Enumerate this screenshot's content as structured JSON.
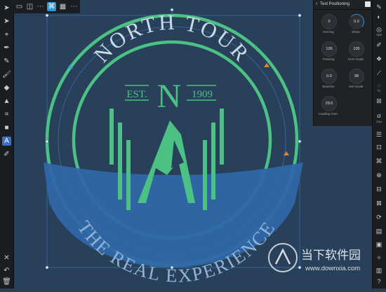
{
  "panel": {
    "title": "Text Positioning",
    "controls": [
      {
        "label": "Kerning",
        "value": "0"
      },
      {
        "label": "Shear",
        "value": "0.0"
      },
      {
        "label": "Tracking",
        "value": "126"
      },
      {
        "label": "Horz Scale",
        "value": "105"
      },
      {
        "label": "Baseline",
        "value": "0.0"
      },
      {
        "label": "Vert Scale",
        "value": "99"
      },
      {
        "label": "Leading Over.",
        "value": "29.0"
      }
    ]
  },
  "right_toolbar": {
    "labels": [
      "Ape",
      "fx",
      "20pt"
    ]
  },
  "logo": {
    "top_text": "NORTH TOUR",
    "bottom_text": "THE REAL EXPERIENCE",
    "est": "EST.",
    "letter": "N",
    "year": "1909"
  },
  "watermark": {
    "brand": "当下软件园",
    "url": "www.downxia.com"
  },
  "colors": {
    "green": "#4cc184",
    "banner": "#2f67a8",
    "canvas": "#28405a",
    "text": "#c9dbe8"
  }
}
